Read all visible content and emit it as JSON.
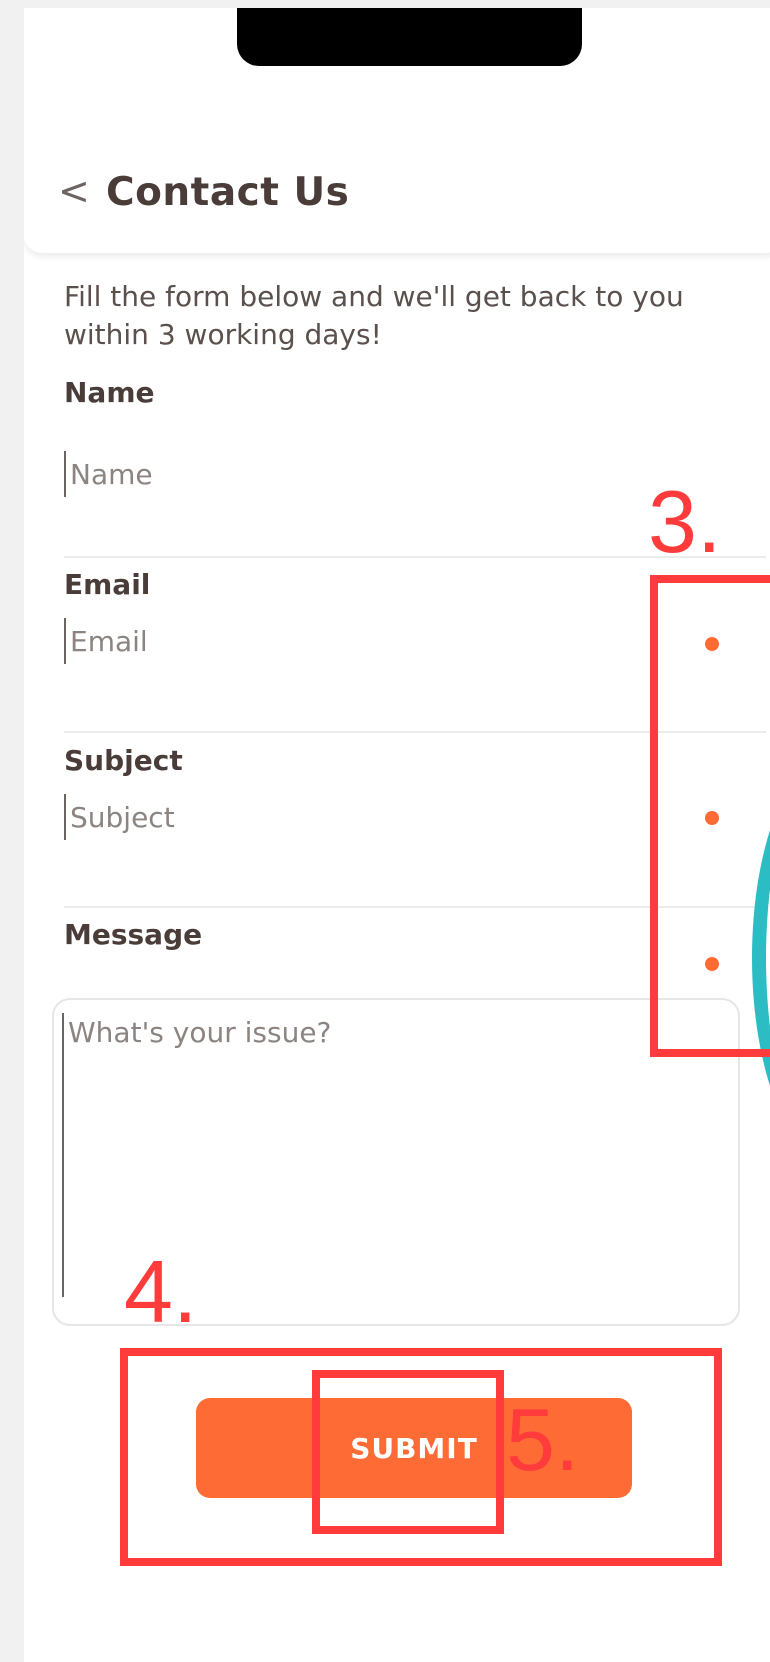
{
  "header": {
    "back_icon": "chevron-left-icon",
    "back_glyph": "<",
    "title": "Contact Us"
  },
  "intro_text": "Fill the form below and we'll get back to you within 3 working days!",
  "form": {
    "name": {
      "label": "Name",
      "placeholder": "Name"
    },
    "email": {
      "label": "Email",
      "placeholder": "Email"
    },
    "subject": {
      "label": "Subject",
      "placeholder": "Subject"
    },
    "message": {
      "label": "Message",
      "placeholder": "What's your issue?"
    },
    "submit_label": "SUBMIT"
  },
  "annotations": {
    "marker_3": "3.",
    "marker_4": "4.",
    "marker_5": "5."
  },
  "colors": {
    "accent": "#ff6b35",
    "annotation": "#ff3b3b",
    "teal": "#2bbcc4",
    "text": "#4a3d39"
  }
}
